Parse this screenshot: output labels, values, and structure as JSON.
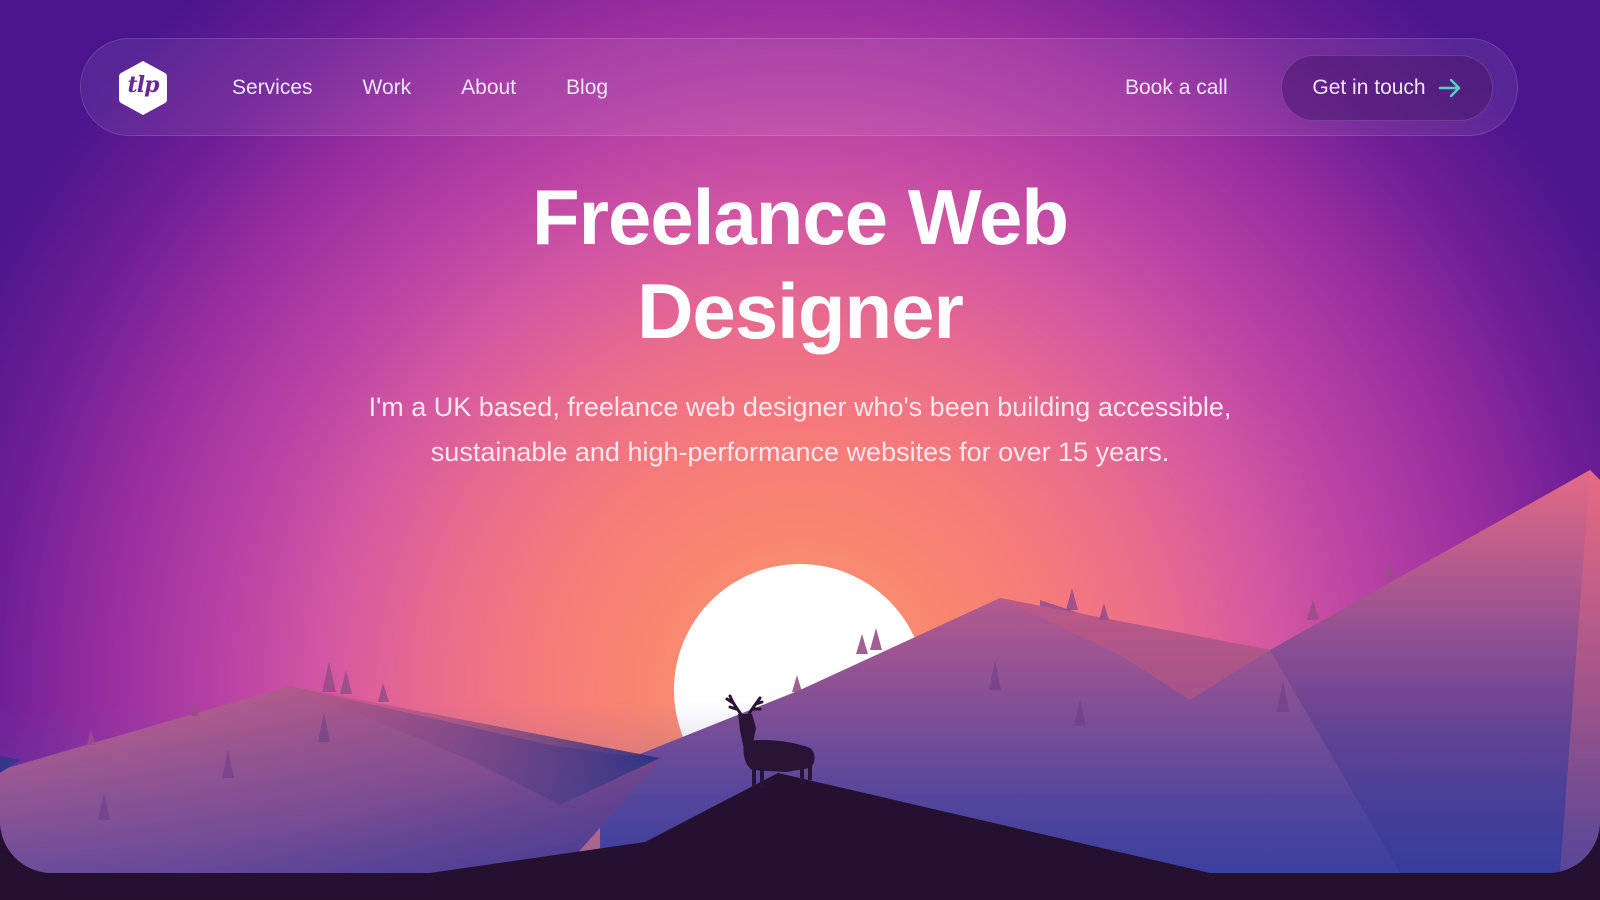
{
  "nav": {
    "logo_text": "tlp",
    "links": [
      {
        "label": "Services"
      },
      {
        "label": "Work"
      },
      {
        "label": "About"
      },
      {
        "label": "Blog"
      }
    ],
    "book_call": "Book a call",
    "cta_label": "Get in touch",
    "cta_icon": "arrow-right-icon"
  },
  "hero": {
    "headline_line1": "Freelance Web",
    "headline_line2": "Designer",
    "subtext": "I'm a UK based, freelance web designer who's been building accessible, sustainable and high-performance websites for over 15 years.",
    "illustration": "sunset mountains with stag silhouette"
  },
  "colors": {
    "sky_top": "#4b168d",
    "sky_mid": "#c24aa8",
    "sky_glow": "#fb9d84",
    "foreground": "#24102f",
    "cta_arrow": "#4fd1c5"
  }
}
